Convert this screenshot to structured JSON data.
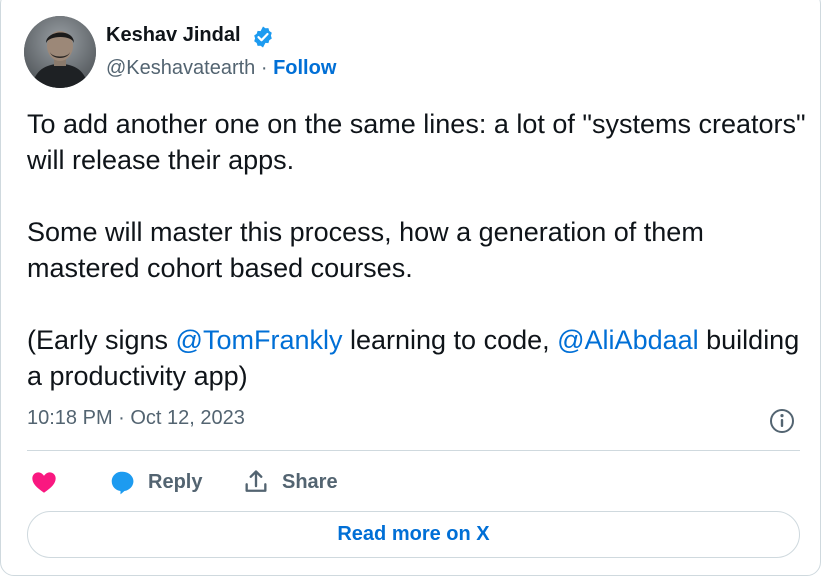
{
  "author": {
    "name": "Keshav Jindal",
    "handle": "@Keshavatearth",
    "separator": " · ",
    "follow_label": "Follow",
    "verified_color": "#1d9bf0",
    "avatar_icon": "profile-photo"
  },
  "tweet": {
    "para1": "To add another one on the same lines: a lot of \"systems creators\" will release their apps.",
    "para2": "Some will master this process, how a generation of them mastered cohort based courses.",
    "para3_prefix": "(Early signs ",
    "mention1": "@TomFrankly",
    "para3_middle": " learning to code, ",
    "mention2": "@AliAbdaal",
    "para3_suffix": " building a productivity app)",
    "timestamp": "10:18 PM · Oct 12, 2023"
  },
  "actions": {
    "like_icon": "heart-icon",
    "like_color": "#f91880",
    "reply_label": "Reply",
    "reply_icon": "speech-bubble-icon",
    "reply_color": "#1d9bf0",
    "share_label": "Share",
    "share_icon": "share-upload-icon"
  },
  "footer": {
    "read_more_label": "Read more on X"
  },
  "colors": {
    "link": "#006fd6",
    "muted": "#536471",
    "border": "#cfd9de"
  }
}
